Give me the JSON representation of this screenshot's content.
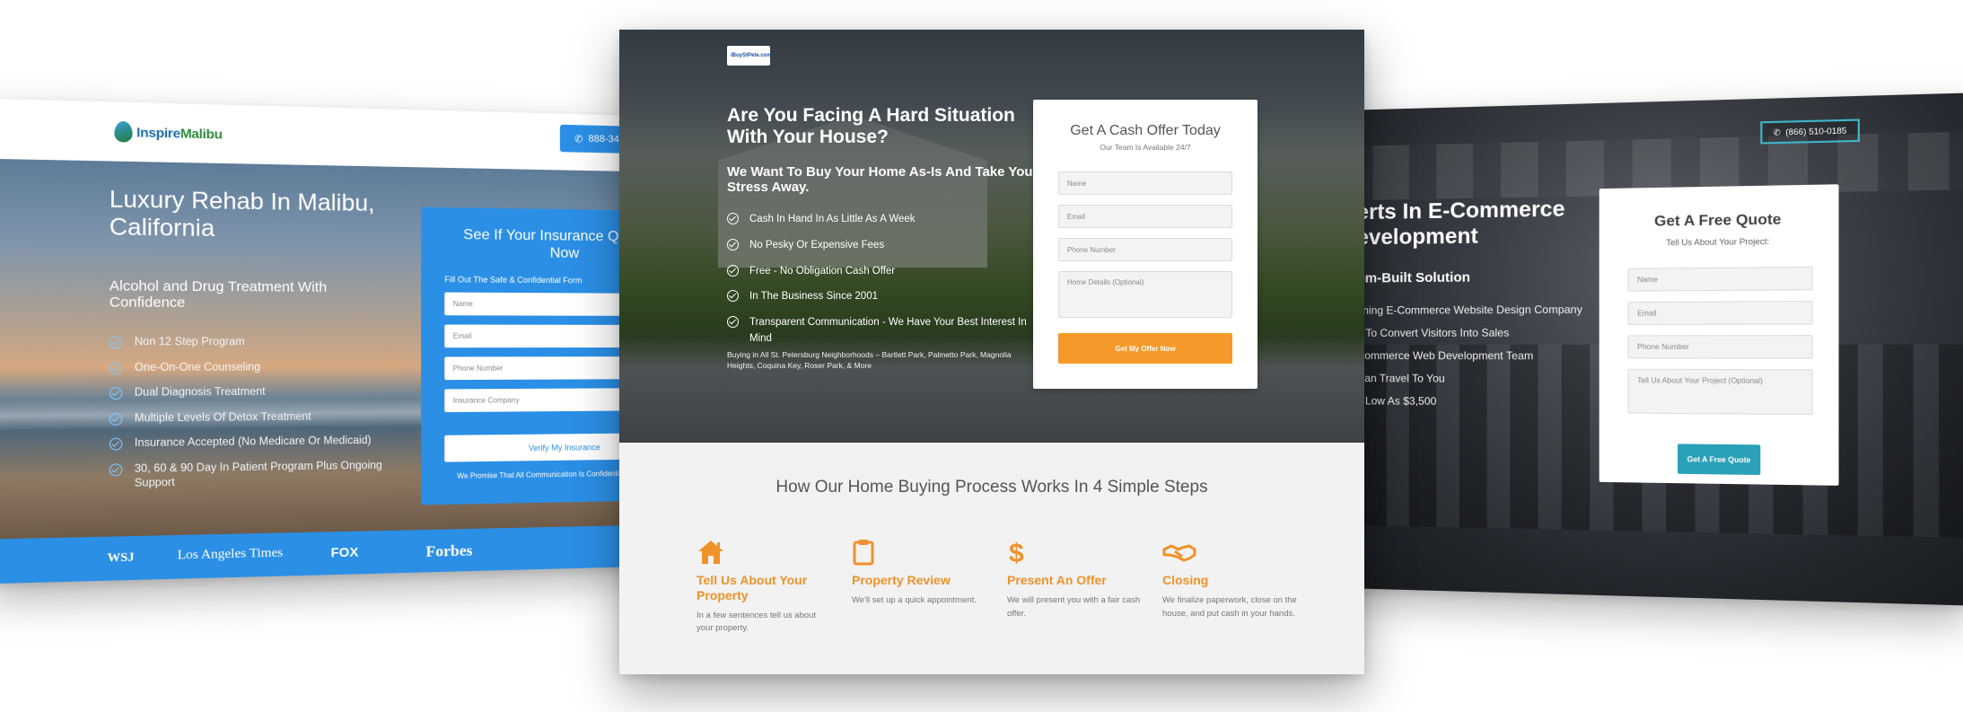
{
  "left_page": {
    "logo_text_a": "Inspire",
    "logo_text_b": "Malibu",
    "phone": "888-34",
    "headline": "Luxury Rehab In Malibu, California",
    "subheadline": "Alcohol and Drug Treatment With Confidence",
    "bullets": [
      "Non 12 Step Program",
      "One-On-One Counseling",
      "Dual Diagnosis Treatment",
      "Multiple Levels Of Detox Treatment",
      "Insurance Accepted (No Medicare Or Medicaid)",
      "30, 60 & 90 Day In Patient Program Plus Ongoing Support"
    ],
    "form": {
      "title": "See If Your Insurance Qualifies Now",
      "subtitle": "Fill Out The Safe & Confidential Form",
      "fields": [
        "Name",
        "Email",
        "Phone Number",
        "Insurance Company"
      ],
      "button": "Verify My Insurance",
      "promise": "We Promise That All Communication Is Confidential & Judge Free"
    },
    "press": [
      "WSJ",
      "Los Angeles Times",
      "FOX",
      "Forbes"
    ]
  },
  "center_page": {
    "logo_text": "iBuyStPete.com",
    "headline": "Are You Facing A Hard Situation With Your House?",
    "subheadline": "We Want To Buy Your Home As-Is And Take Your Stress Away.",
    "bullets": [
      "Cash In Hand In As Little As A Week",
      "No Pesky Or Expensive Fees",
      "Free - No Obligation Cash Offer",
      "In The Business Since 2001",
      "Transparent Communication - We Have Your Best Interest In Mind"
    ],
    "areas": "Buying in All St. Petersburg Neighborhoods – Bartlett Park, Palmetto Park, Magnolia Heights, Coquina Key, Roser Park, & More",
    "form": {
      "title": "Get A Cash Offer Today",
      "subtitle": "Our Team Is Available 24/7",
      "fields": [
        "Name",
        "Email",
        "Phone Number",
        "Home Details (Optional)"
      ],
      "button": "Get My Offer Now"
    },
    "steps_title": "How Our Home Buying Process Works In 4 Simple Steps",
    "steps": [
      {
        "icon": "home-icon",
        "title": "Tell Us About Your Property",
        "desc": "In a few sentences tell us about your property."
      },
      {
        "icon": "clipboard-icon",
        "title": "Property Review",
        "desc": "We'll set up a quick appointment."
      },
      {
        "icon": "dollar-icon",
        "title": "Present An Offer",
        "desc": "We will present you with a fair cash offer."
      },
      {
        "icon": "handshake-icon",
        "title": "Closing",
        "desc": "We finalize paperwork, close on the house, and put cash in your hands."
      }
    ],
    "accent_color": "#f0922a"
  },
  "right_page": {
    "phone": "(866) 510-0185",
    "headline_line1": "erts In E-Commerce",
    "headline_line2": "evelopment",
    "subheadline": "om-Built Solution",
    "bullets": [
      "nning E-Commerce Website Design Company",
      "d To Convert Visitors Into Sales",
      "Commerce Web Development Team",
      "Can Travel To You",
      "s Low As $3,500"
    ],
    "form": {
      "title": "Get A Free Quote",
      "subtitle": "Tell Us About Your Project:",
      "fields": [
        "Name",
        "Email",
        "Phone Number",
        "Tell Us About Your Project (Optional)"
      ],
      "button": "Get A Free Quote"
    },
    "accent_color": "#2aa1b8"
  }
}
